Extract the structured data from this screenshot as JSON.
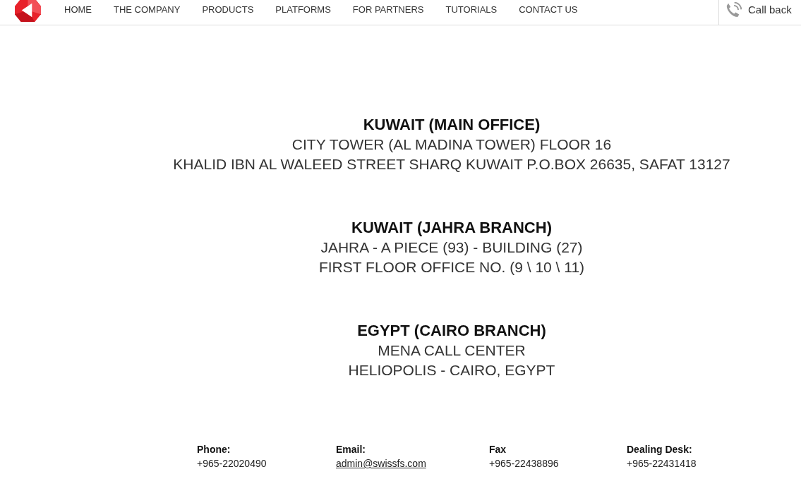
{
  "header": {
    "nav": [
      "HOME",
      "THE COMPANY",
      "PRODUCTS",
      "PLATFORMS",
      "FOR PARTNERS",
      "TUTORIALS",
      "CONTACT US"
    ],
    "call_back": "Call back"
  },
  "offices": [
    {
      "title": "KUWAIT (MAIN OFFICE)",
      "lines": [
        "CITY TOWER (AL MADINA TOWER) FLOOR 16",
        "KHALID IBN AL WALEED STREET SHARQ KUWAIT P.O.BOX 26635, SAFAT 13127"
      ]
    },
    {
      "title": "KUWAIT (JAHRA BRANCH)",
      "lines": [
        "JAHRA - A PIECE (93) - BUILDING (27)",
        "FIRST FLOOR OFFICE NO. (9 \\ 10 \\ 11)"
      ]
    },
    {
      "title": "EGYPT (CAIRO BRANCH)",
      "lines": [
        "MENA CALL CENTER",
        "HELIOPOLIS - CAIRO, EGYPT"
      ]
    }
  ],
  "contacts": [
    {
      "label": "Phone:",
      "value": "+965-22020490",
      "kind": "text"
    },
    {
      "label": "Email:",
      "value": "admin@swissfs.com",
      "kind": "link"
    },
    {
      "label": "Fax",
      "value": "+965-22438896",
      "kind": "text"
    },
    {
      "label": "Dealing Desk:",
      "value": "+965-22431418",
      "kind": "text"
    }
  ]
}
